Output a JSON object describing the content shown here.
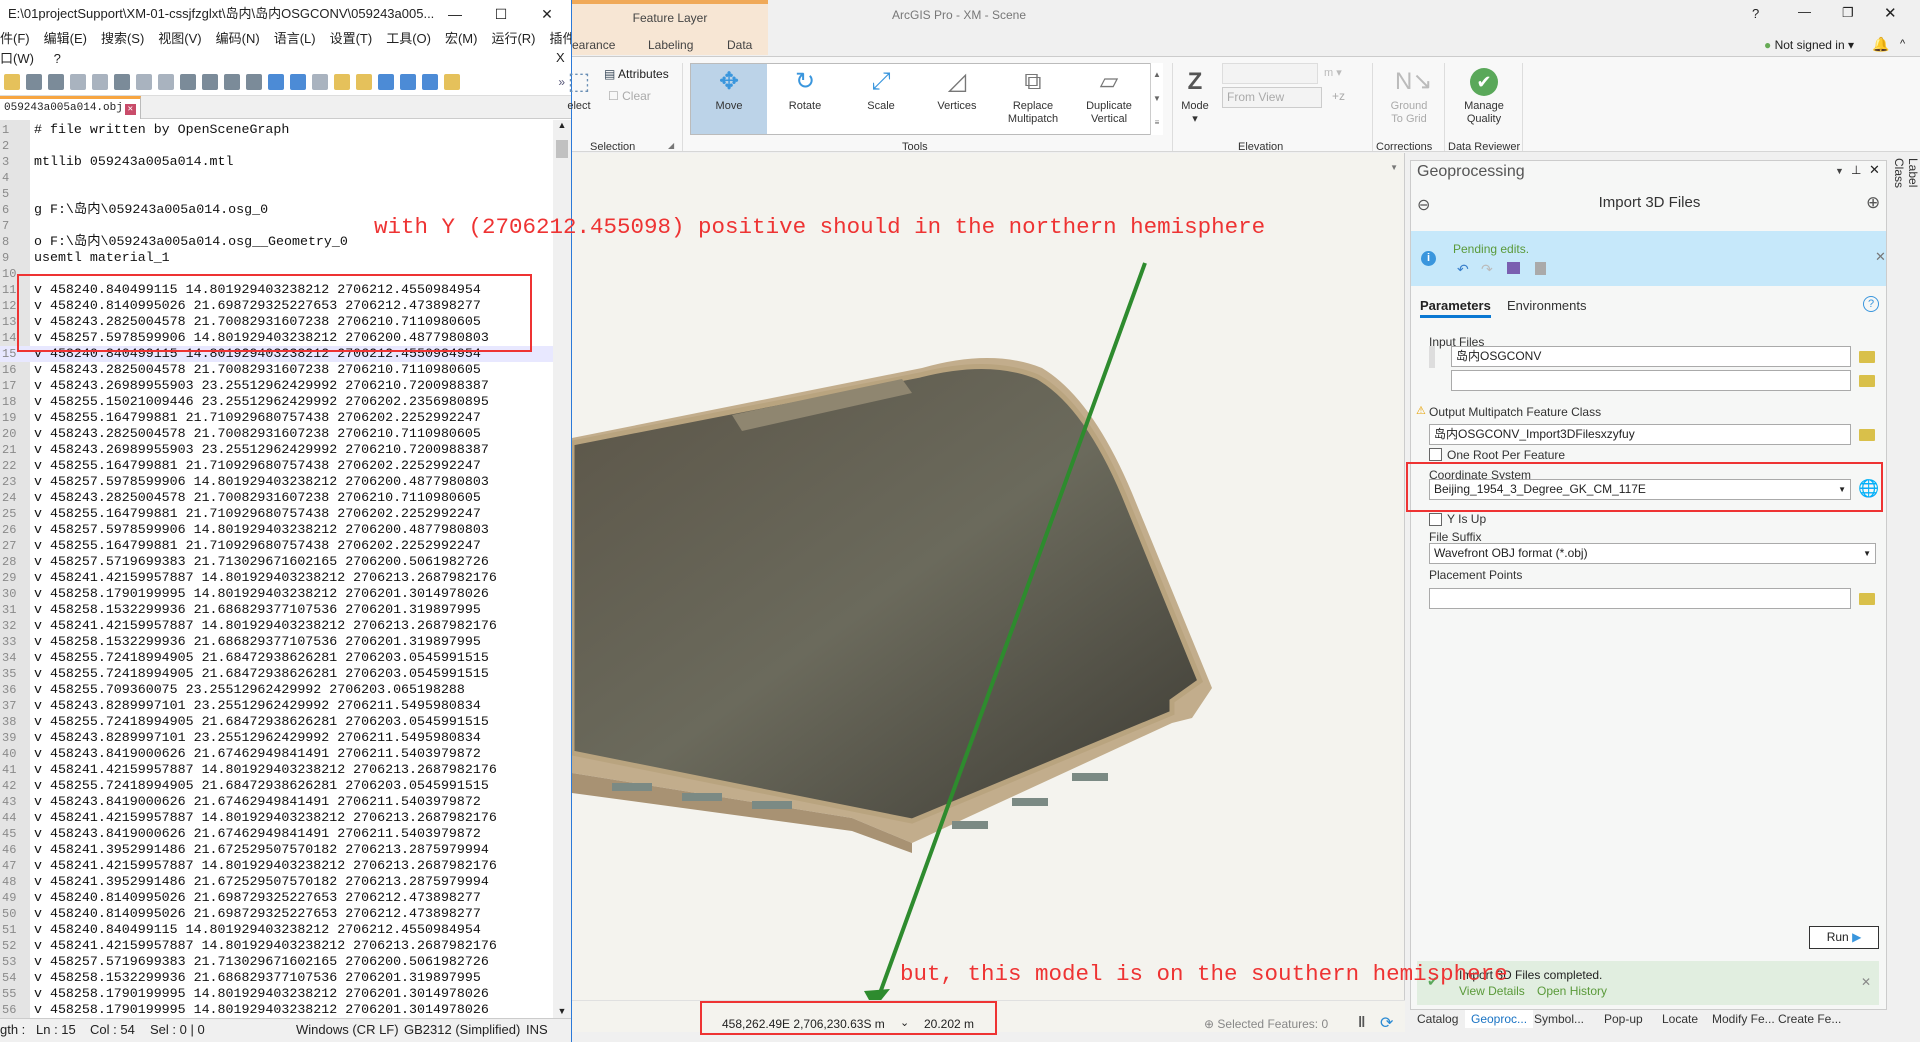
{
  "notepad": {
    "title": "E:\\01projectSupport\\XM-01-cssjfzglxt\\岛内\\岛内OSGCONV\\059243a005...",
    "menu": [
      "件(F)",
      "编辑(E)",
      "搜索(S)",
      "视图(V)",
      "编码(N)",
      "语言(L)",
      "设置(T)",
      "工具(O)",
      "宏(M)",
      "运行(R)",
      "插件(P)"
    ],
    "menu2": [
      "口(W)",
      "?"
    ],
    "tab": "059243a005a014.obj",
    "current_line": 15,
    "lines": [
      "# file written by OpenSceneGraph",
      "",
      "mtllib 059243a005a014.mtl",
      "",
      "",
      "g F:\\岛内\\059243a005a014.osg_0",
      "",
      "o F:\\岛内\\059243a005a014.osg__Geometry_0",
      "usemtl material_1",
      "",
      "v 458240.840499115 14.801929403238212 2706212.4550984954",
      "v 458240.8140995026 21.698729325227653 2706212.473898277",
      "v 458243.2825004578 21.70082931607238 2706210.7110980605",
      "v 458257.5978599906 14.801929403238212 2706200.4877980803",
      "v 458240.840499115 14.801929403238212 2706212.4550984954",
      "v 458243.2825004578 21.70082931607238 2706210.7110980605",
      "v 458243.26989955903 23.25512962429992 2706210.7200988387",
      "v 458255.15021009446 23.25512962429992 2706202.2356980895",
      "v 458255.164799881 21.710929680757438 2706202.2252992247",
      "v 458243.2825004578 21.70082931607238 2706210.7110980605",
      "v 458243.26989955903 23.25512962429992 2706210.7200988387",
      "v 458255.164799881 21.710929680757438 2706202.2252992247",
      "v 458257.5978599906 14.801929403238212 2706200.4877980803",
      "v 458243.2825004578 21.70082931607238 2706210.7110980605",
      "v 458255.164799881 21.710929680757438 2706202.2252992247",
      "v 458257.5978599906 14.801929403238212 2706200.4877980803",
      "v 458255.164799881 21.710929680757438 2706202.2252992247",
      "v 458257.5719699383 21.713029671602165 2706200.5061982726",
      "v 458241.42159957887 14.801929403238212 2706213.2687982176",
      "v 458258.1790199995 14.801929403238212 2706201.3014978026",
      "v 458258.1532299936 21.686829377107536 2706201.319897995",
      "v 458241.42159957887 14.801929403238212 2706213.2687982176",
      "v 458258.1532299936 21.686829377107536 2706201.319897995",
      "v 458255.72418994905 21.68472938626281 2706203.0545991515",
      "v 458255.72418994905 21.68472938626281 2706203.0545991515",
      "v 458255.709360075 23.25512962429992 2706203.065198288",
      "v 458243.8289997101 23.25512962429992 2706211.5495980834",
      "v 458255.72418994905 21.68472938626281 2706203.0545991515",
      "v 458243.8289997101 23.25512962429992 2706211.5495980834",
      "v 458243.8419000626 21.67462949841491 2706211.5403979872",
      "v 458241.42159957887 14.801929403238212 2706213.2687982176",
      "v 458255.72418994905 21.68472938626281 2706203.0545991515",
      "v 458243.8419000626 21.67462949841491 2706211.5403979872",
      "v 458241.42159957887 14.801929403238212 2706213.2687982176",
      "v 458243.8419000626 21.67462949841491 2706211.5403979872",
      "v 458241.3952991486 21.672529507570182 2706213.2875979994",
      "v 458241.42159957887 14.801929403238212 2706213.2687982176",
      "v 458241.3952991486 21.672529507570182 2706213.2875979994",
      "v 458240.8140995026 21.698729325227653 2706212.473898277",
      "v 458240.8140995026 21.698729325227653 2706212.473898277",
      "v 458240.840499115 14.801929403238212 2706212.4550984954",
      "v 458241.42159957887 14.801929403238212 2706213.2687982176",
      "v 458257.5719699383 21.713029671602165 2706200.5061982726",
      "v 458258.1532299936 21.686829377107536 2706201.319897995",
      "v 458258.1790199995 14.801929403238212 2706201.3014978026",
      "v 458258.1790199995 14.801929403238212 2706201.3014978026"
    ],
    "status": {
      "length": "gth :",
      "ln": "Ln : 15",
      "col": "Col : 54",
      "sel": "Sel : 0 | 0",
      "eol": "Windows (CR LF)",
      "enc": "GB2312 (Simplified)",
      "mode": "INS"
    }
  },
  "arcgis": {
    "title": "ArcGIS Pro - XM - Scene",
    "context_tab": "Feature Layer",
    "tabs": [
      "earance",
      "Labeling",
      "Data"
    ],
    "signin": "Not signed in",
    "selection": {
      "select": "elect",
      "attributes": "Attributes",
      "clear": "Clear",
      "group": "Selection"
    },
    "tools": [
      {
        "label": "Move",
        "icon": "move-arrows"
      },
      {
        "label": "Rotate",
        "icon": "rotate"
      },
      {
        "label": "Scale",
        "icon": "scale-arrows"
      },
      {
        "label": "Vertices",
        "icon": "vertices"
      },
      {
        "label": "Replace\nMultipatch",
        "icon": "replace-multipatch"
      },
      {
        "label": "Duplicate\nVertical",
        "icon": "duplicate-vertical"
      }
    ],
    "tools_group": "Tools",
    "elevation": {
      "mode": "Mode",
      "unit": "m",
      "from_view": "From View",
      "group": "Elevation"
    },
    "corrections": {
      "ground": "Ground\nTo Grid",
      "group": "Corrections"
    },
    "reviewer": {
      "manage": "Manage\nQuality",
      "group": "Data Reviewer"
    },
    "accent": "#3a96dd",
    "map_status": {
      "coords": "458,262.49E 2,706,230.63S m",
      "elev": "20.202 m",
      "selected": "Selected Features: 0"
    },
    "gp": {
      "pane_title": "Geoprocessing",
      "tool_title": "Import 3D Files",
      "pending": "Pending edits.",
      "tab_params": "Parameters",
      "tab_env": "Environments",
      "input_files_label": "Input Files",
      "input_files": [
        "岛内OSGCONV",
        ""
      ],
      "output_label": "Output Multipatch Feature Class",
      "output_value": "岛内OSGCONV_Import3DFilesxzyfuy",
      "one_root": "One Root Per Feature",
      "cs_label": "Coordinate System",
      "cs_value": "Beijing_1954_3_Degree_GK_CM_117E",
      "y_up": "Y Is Up",
      "suffix_label": "File Suffix",
      "suffix_value": "Wavefront OBJ format (*.obj)",
      "placement_label": "Placement Points",
      "placement_value": "",
      "run": "Run",
      "done": "Import 3D Files completed.",
      "view_details": "View Details",
      "open_history": "Open History"
    },
    "side_tab": "Label Class",
    "bottom_tabs": [
      "Catalog",
      "Geoproc...",
      "Symbol...",
      "Pop-up",
      "Locate",
      "Modify Fe...",
      "Create Fe..."
    ]
  },
  "annotations": {
    "top": "with Y (2706212.455098) positive should in the northern hemisphere",
    "bottom": "but, this model is on the southern hemisphere"
  }
}
